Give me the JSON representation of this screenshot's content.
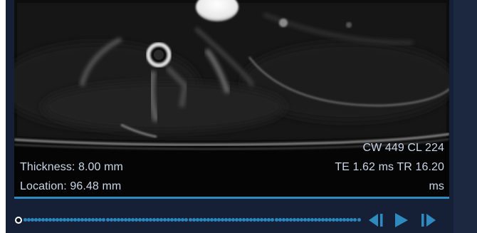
{
  "viewer": {
    "thickness": "Thickness: 8.00 mm",
    "location": "Location: 96.48 mm",
    "window": "CW 449 CL 224",
    "timing_line1": "TE 1.62 ms TR 16.20",
    "timing_line2": "ms"
  },
  "playback": {
    "frame_count": 95,
    "current_frame": 1,
    "icons": {
      "prev": "step-backward-icon",
      "play": "play-icon",
      "next": "step-forward-icon"
    }
  },
  "colors": {
    "accent": "#2f8bbf",
    "overlay_text": "#c9d6e6",
    "background": "#152036"
  }
}
